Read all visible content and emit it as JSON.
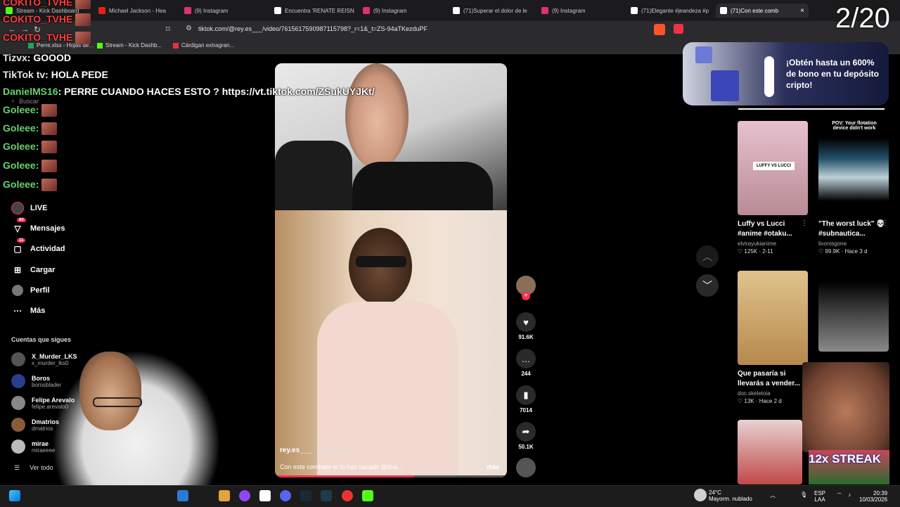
{
  "browser": {
    "tabs": [
      {
        "label": "Stream - Kick Dashboard",
        "color": "#53fc18"
      },
      {
        "label": "Michael Jackson - Hea",
        "color": "#e62117"
      },
      {
        "label": "(9) Instagram",
        "color": "#e1306c"
      },
      {
        "label": "Encuentra 'RENATE REISN",
        "color": "#ffffff"
      },
      {
        "label": "(9) Instagram",
        "color": "#e1306c"
      },
      {
        "label": "(71)Superar el dolor de le",
        "color": "#ffffff"
      },
      {
        "label": "(9) Instagram",
        "color": "#e1306c"
      },
      {
        "label": "(71)Elegante #jeandeza #p",
        "color": "#ffffff"
      },
      {
        "label": "(71)Con este comb",
        "color": "#ffffff",
        "active": true
      }
    ],
    "url": "tiktok.com/@rey.es___/video/7615617590987115798?_r=1&_t=ZS-94aTKezduPF",
    "bookmarks": [
      {
        "label": "Perre.xlsx - Hojas de...",
        "color": "#1fa463"
      },
      {
        "label": "Stream - Kick Dashb...",
        "color": "#53fc18"
      },
      {
        "label": "Cárdigan extragran...",
        "color": "#e53238"
      }
    ]
  },
  "sidebar": {
    "search_placeholder": "Buscar",
    "nav": [
      {
        "label": "LIVE",
        "icon": "live-icon"
      },
      {
        "label": "Mensajes",
        "icon": "message-icon",
        "badge": "60"
      },
      {
        "label": "Actividad",
        "icon": "activity-icon",
        "badge": "11"
      },
      {
        "label": "Cargar",
        "icon": "upload-icon"
      },
      {
        "label": "Perfil",
        "icon": "profile-icon"
      },
      {
        "label": "Más",
        "icon": "more-icon"
      }
    ],
    "following_title": "Cuentas que sigues",
    "following": [
      {
        "name": "X_Murder_LKS",
        "handle": "x_murder_lks0"
      },
      {
        "name": "Boros",
        "handle": "borosblader"
      },
      {
        "name": "Felipe Arevalo",
        "handle": "felipe.arevalo0"
      },
      {
        "name": "Dmatrios",
        "handle": "dmatrios"
      },
      {
        "name": "mirae",
        "handle": "miraeeee"
      }
    ],
    "see_all": "Ver todo"
  },
  "video": {
    "author": "rey.es___",
    "time": " · Hace 12 h",
    "caption": "Con este combate te lo has sacado @Ibai...",
    "more": "más",
    "progress_pct": 60,
    "likes": "91.6K",
    "comments": "244",
    "saves": "7014",
    "shares": "50.1K"
  },
  "ad": {
    "text": "¡Obtén hasta un 600% de bono en tu depósito cripto!"
  },
  "recommendations": [
    {
      "title": "Luffy vs Lucci #anime #otaku...",
      "author": "elvirayukianime",
      "meta": "♡ 125K · 2-11",
      "thumb_text": "LUFFY VS LUCCI",
      "color": "#d8a7b5"
    },
    {
      "title": "\"The worst luck\" 💀 #subnautica...",
      "author": "lixonisgone",
      "meta": "♡ 99.9K · Hace 3 d",
      "thumb_text": "POV: Your flotation device didn't work",
      "color": "#23384a"
    },
    {
      "title": "Que pasaría si llevarás a vender...",
      "author": "doc.skeletoia",
      "meta": "♡ 13K · Hace 2 d",
      "thumb_text": "",
      "color": "#c9a56b"
    },
    {
      "title": "",
      "author": "",
      "meta": "",
      "thumb_text": "",
      "color": "#3a3a3a"
    }
  ],
  "chat": [
    {
      "user": "COKITO_TVHE",
      "text": "",
      "kind": "red"
    },
    {
      "user": "COKITO_TVHE",
      "text": "",
      "kind": "red"
    },
    {
      "user": "COKITO_TVHE",
      "text": "",
      "kind": "red"
    },
    {
      "user": "Tizvx",
      "text": ": GOOOD",
      "kind": "white"
    },
    {
      "user": "TikTok tv",
      "text": ": HOLA PEDE",
      "kind": "white"
    },
    {
      "user": "DanielMS16",
      "text": ": PERRE CUANDO HACES ESTO ? https://vt.tiktok.com/ZSukUYJKt/",
      "kind": "green"
    },
    {
      "user": "Goleee:",
      "text": "",
      "kind": "green"
    },
    {
      "user": "Goleee:",
      "text": "",
      "kind": "green"
    },
    {
      "user": "Goleee:",
      "text": "",
      "kind": "green"
    },
    {
      "user": "Goleee:",
      "text": "",
      "kind": "green"
    },
    {
      "user": "Goleee:",
      "text": "",
      "kind": "green"
    }
  ],
  "counter": "2/20",
  "streak": "12x STREAK",
  "taskbar": {
    "weather_temp": "24°C",
    "weather_desc": "Mayorm. nublado",
    "lang": "ESP",
    "lang2": "LAA",
    "time": "20:39",
    "date": "10/03/2026"
  }
}
